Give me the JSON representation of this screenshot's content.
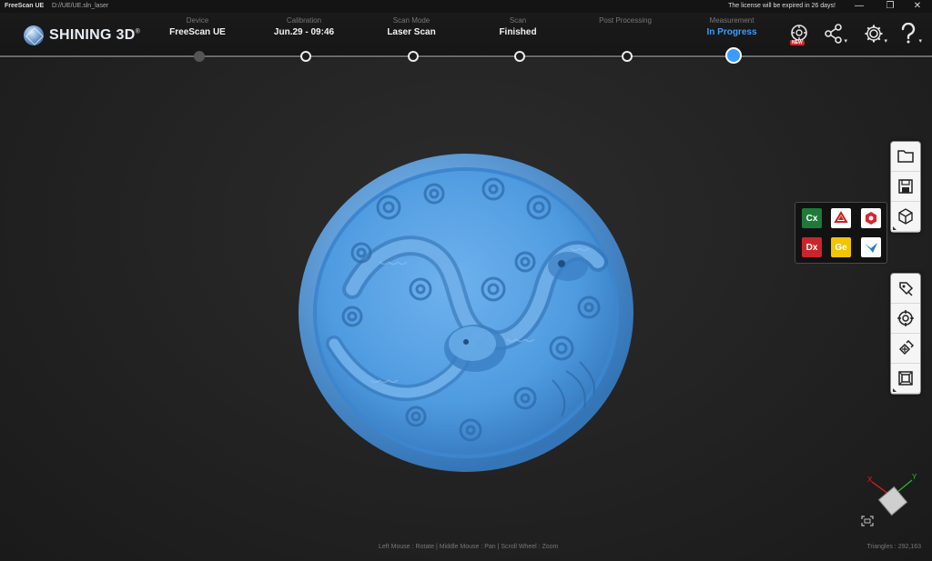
{
  "titlebar": {
    "app_name": "FreeScan UE",
    "separator": "-",
    "path": "D://UE/UE.sln_laser",
    "license_notice": "The license will be expired in 26 days!",
    "minimize": "—",
    "restore": "❐",
    "close": "✕"
  },
  "header": {
    "logo_text": "SHINING 3D",
    "logo_reg": "®",
    "steps": [
      {
        "label": "Device",
        "value": "FreeScan UE",
        "state": "done"
      },
      {
        "label": "Calibration",
        "value": "Jun.29 - 09:46",
        "state": "done"
      },
      {
        "label": "Scan Mode",
        "value": "Laser Scan",
        "state": "done"
      },
      {
        "label": "Scan",
        "value": "Finished",
        "state": "done"
      },
      {
        "label": "Post Processing",
        "value": "",
        "state": "pending"
      },
      {
        "label": "Measurement",
        "value": "In Progress",
        "state": "current"
      }
    ],
    "icons": [
      "new-feature-icon",
      "share-icon",
      "settings-icon",
      "help-icon"
    ],
    "new_badge": "NEW",
    "accent_color": "#3b9cff"
  },
  "toolbar_top": [
    "folder-icon",
    "save-icon",
    "cube-view-icon"
  ],
  "toolbar_bottom": [
    "paint-select-icon",
    "target-icon",
    "repair-icon",
    "layers-icon"
  ],
  "export_panel": {
    "items": [
      {
        "label": "Cx",
        "bg": "#1f7a3a",
        "fg": "#ffffff",
        "name": "cx-export"
      },
      {
        "label": "",
        "bg": "#ffffff",
        "fg": "#cc2020",
        "name": "geomagic-export"
      },
      {
        "label": "",
        "bg": "#ffffff",
        "fg": "#d8262c",
        "name": "shape-export"
      },
      {
        "label": "Dx",
        "bg": "#c8262c",
        "fg": "#ffffff",
        "name": "dx-export"
      },
      {
        "label": "Ge",
        "bg": "#f2c500",
        "fg": "#ffffff",
        "name": "ge-export"
      },
      {
        "label": "",
        "bg": "#ffffff",
        "fg": "#2b78d0",
        "name": "bird-export"
      }
    ]
  },
  "status_bar": {
    "mouse_hint": "Left Mouse : Rotate | Middle Mouse : Pan | Scroll Wheel : Zoom",
    "triangles": "Triangles : 292,163"
  },
  "axes": {
    "x_label": "X",
    "y_label": "Y",
    "x_color": "#e02020",
    "y_color": "#20c020"
  },
  "model_color": "#4f9be0"
}
